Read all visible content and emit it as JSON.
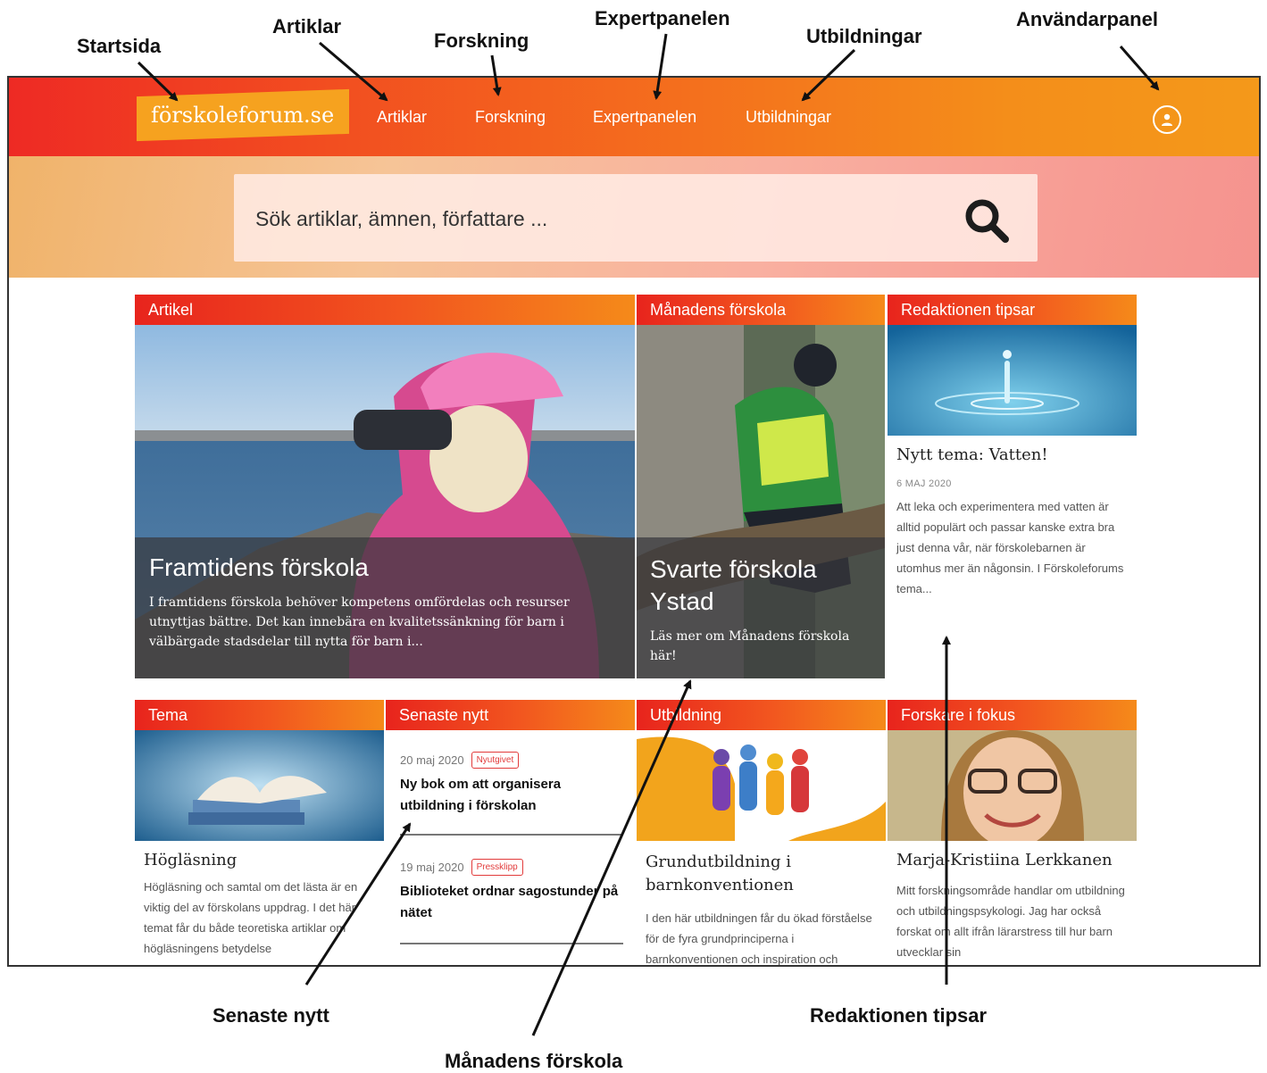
{
  "callouts": {
    "startsida": "Startsida",
    "artiklar": "Artiklar",
    "forskning": "Forskning",
    "expertpanelen": "Expertpanelen",
    "utbildningar": "Utbildningar",
    "anvandarpanel": "Användarpanel",
    "senaste_nytt": "Senaste nytt",
    "manadens_forskola": "Månadens förskola",
    "redaktionen_tipsar": "Redaktionen tipsar"
  },
  "header": {
    "logo": "förskoleforum.se",
    "nav": [
      "Artiklar",
      "Forskning",
      "Expertpanelen",
      "Utbildningar"
    ],
    "user_icon": "user-circle-icon",
    "colors": {
      "gradient_start": "#ee2a24",
      "gradient_end": "#f4991a",
      "logo_bg": "#f6a21f"
    }
  },
  "search": {
    "placeholder": "Sök artiklar, ämnen, författare ...",
    "icon": "search-icon"
  },
  "cards": {
    "artikel": {
      "label": "Artikel",
      "title": "Framtidens förskola",
      "excerpt": "I framtidens förskola behöver kompetens omfördelas och resurser utnyttjas bättre. Det kan innebära en kvalitetssänkning för barn i välbärgade stadsdelar till nytta för barn i..."
    },
    "manadens": {
      "label": "Månadens förskola",
      "title": "Svarte förskola Ystad",
      "excerpt": "Läs mer om Månadens förskola här!"
    },
    "redaktionen": {
      "label": "Redaktionen tipsar",
      "title": "Nytt tema: Vatten!",
      "date": "6 MAJ 2020",
      "text": "Att leka och experimentera med vatten är alltid populärt och passar kanske extra bra just denna vår, när förskolebarnen är utomhus mer än någonsin. I Förskoleforums tema..."
    },
    "tema": {
      "label": "Tema",
      "title": "Högläsning",
      "text": "Högläsning och samtal om det lästa är en viktig del av förskolans uppdrag. I det här temat får du både teoretiska artiklar om högläsningens betydelse"
    },
    "senaste": {
      "label": "Senaste nytt",
      "items": [
        {
          "date": "20 maj 2020",
          "badge": "Nyutgivet",
          "title": "Ny bok om att organisera utbildning i förskolan"
        },
        {
          "date": "19 maj 2020",
          "badge": "Pressklipp",
          "title": "Biblioteket ordnar sagostunder på nätet"
        }
      ]
    },
    "utbildning": {
      "label": "Utbildning",
      "title": "Grundutbildning i barnkonventionen",
      "text": "I den här utbildningen får du ökad förståelse för de fyra grundprinciperna i barnkonventionen och inspiration och"
    },
    "forskare": {
      "label": "Forskare i fokus",
      "title": "Marja-Kristiina Lerkkanen",
      "text": "Mitt forskningsområde handlar om utbildning och utbildningspsykologi. Jag har också forskat om allt ifrån lärarstress till hur barn utvecklar sin"
    }
  }
}
